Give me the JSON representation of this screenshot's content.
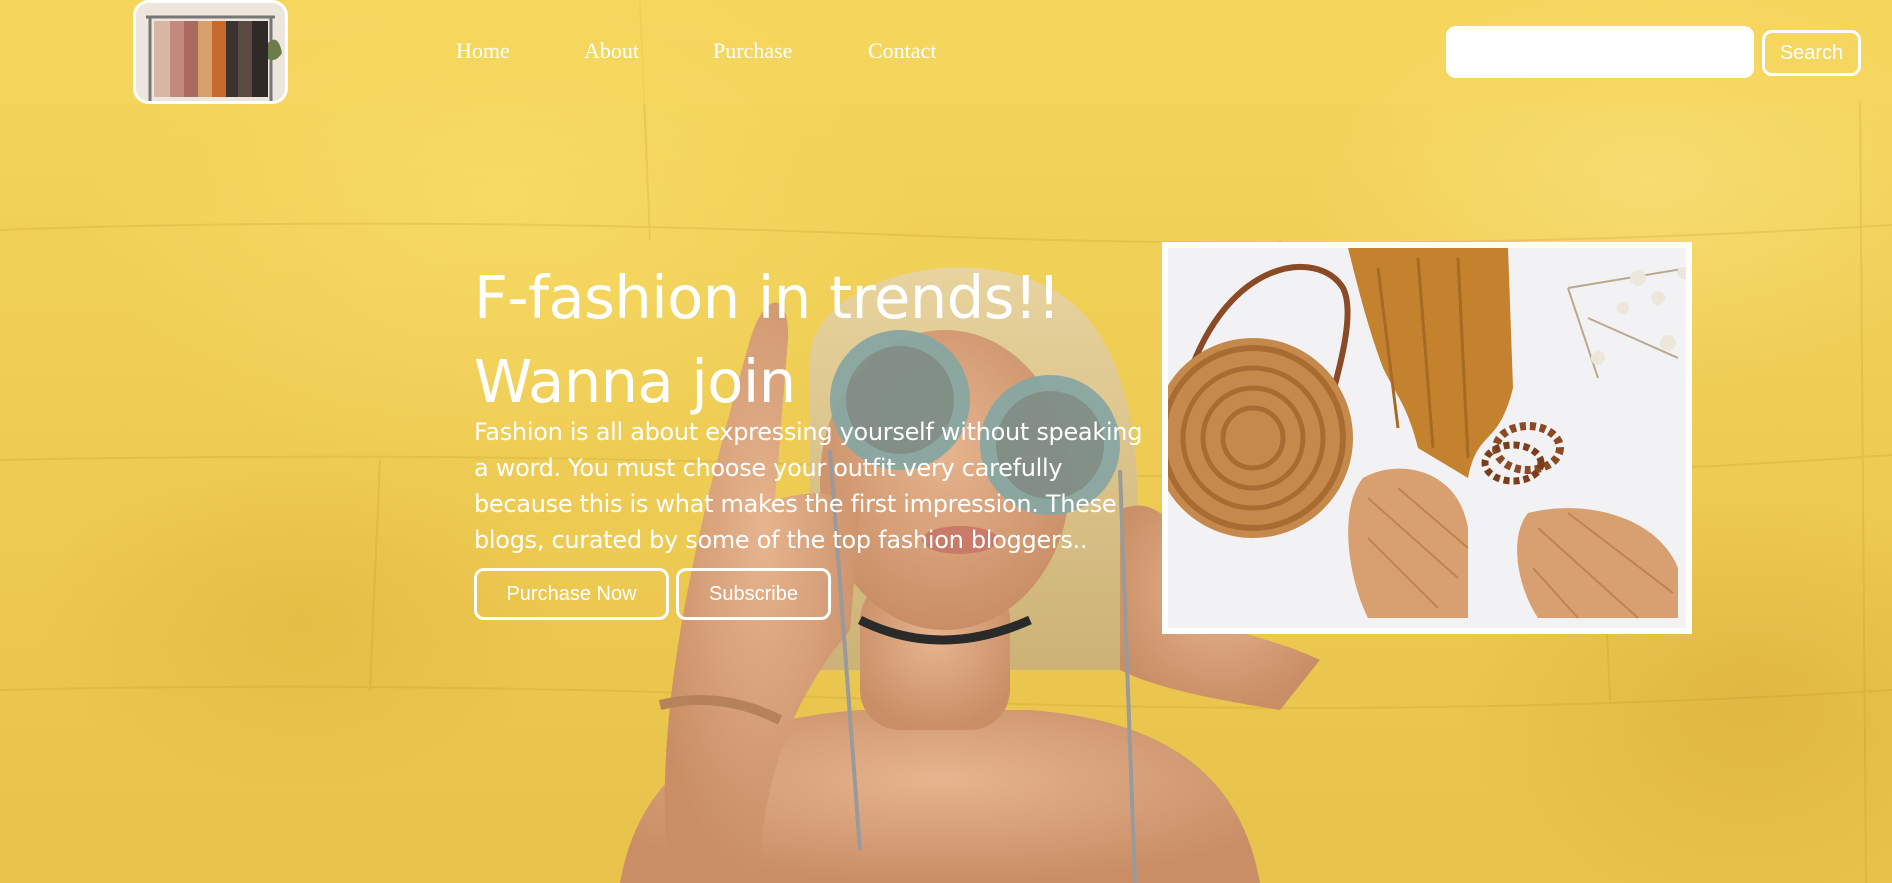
{
  "nav": {
    "items": [
      {
        "label": "Home"
      },
      {
        "label": "About"
      },
      {
        "label": "Purchase"
      },
      {
        "label": "Contact"
      }
    ]
  },
  "search": {
    "value": "",
    "placeholder": "",
    "button_label": "Search"
  },
  "hero": {
    "title_line1": "F-fashion in trends!!",
    "title_line2": "Wanna join",
    "text": "Fashion is all about expressing yourself without speaking a word. You must choose your outfit very carefully because this is what makes the first impression. These blogs, curated by some of the top fashion bloggers..",
    "purchase_label": "Purchase Now",
    "subscribe_label": "Subscribe"
  },
  "colors": {
    "background": "#f0cf55",
    "text": "#ffffff"
  }
}
